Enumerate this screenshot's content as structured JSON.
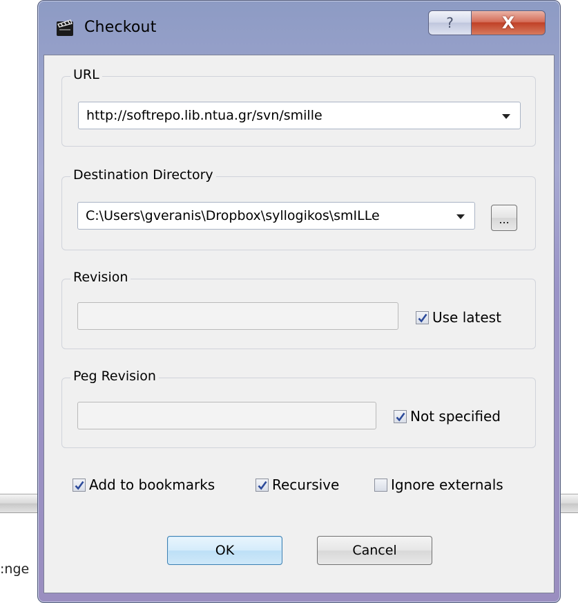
{
  "background": {
    "partial_text": ":nge"
  },
  "window": {
    "title": "Checkout",
    "help_button": "?",
    "close_button": "X"
  },
  "url": {
    "label": "URL",
    "value": "http://softrepo.lib.ntua.gr/svn/smille"
  },
  "destination": {
    "label": "Destination Directory",
    "value": "C:\\Users\\gveranis\\Dropbox\\syllogikos\\smILLe",
    "browse_label": "..."
  },
  "revision": {
    "label": "Revision",
    "value": "",
    "use_latest_label": "Use latest",
    "use_latest_checked": true
  },
  "peg_revision": {
    "label": "Peg Revision",
    "value": "",
    "not_specified_label": "Not specified",
    "not_specified_checked": true
  },
  "options": {
    "add_to_bookmarks_label": "Add to bookmarks",
    "add_to_bookmarks_checked": true,
    "recursive_label": "Recursive",
    "recursive_checked": true,
    "ignore_externals_label": "Ignore externals",
    "ignore_externals_checked": false
  },
  "buttons": {
    "ok": "OK",
    "cancel": "Cancel"
  },
  "colors": {
    "frame": "#9a93c7",
    "close_red": "#c04127",
    "checkmark": "#2c4a9a",
    "ok_border": "#3c7fb1"
  }
}
